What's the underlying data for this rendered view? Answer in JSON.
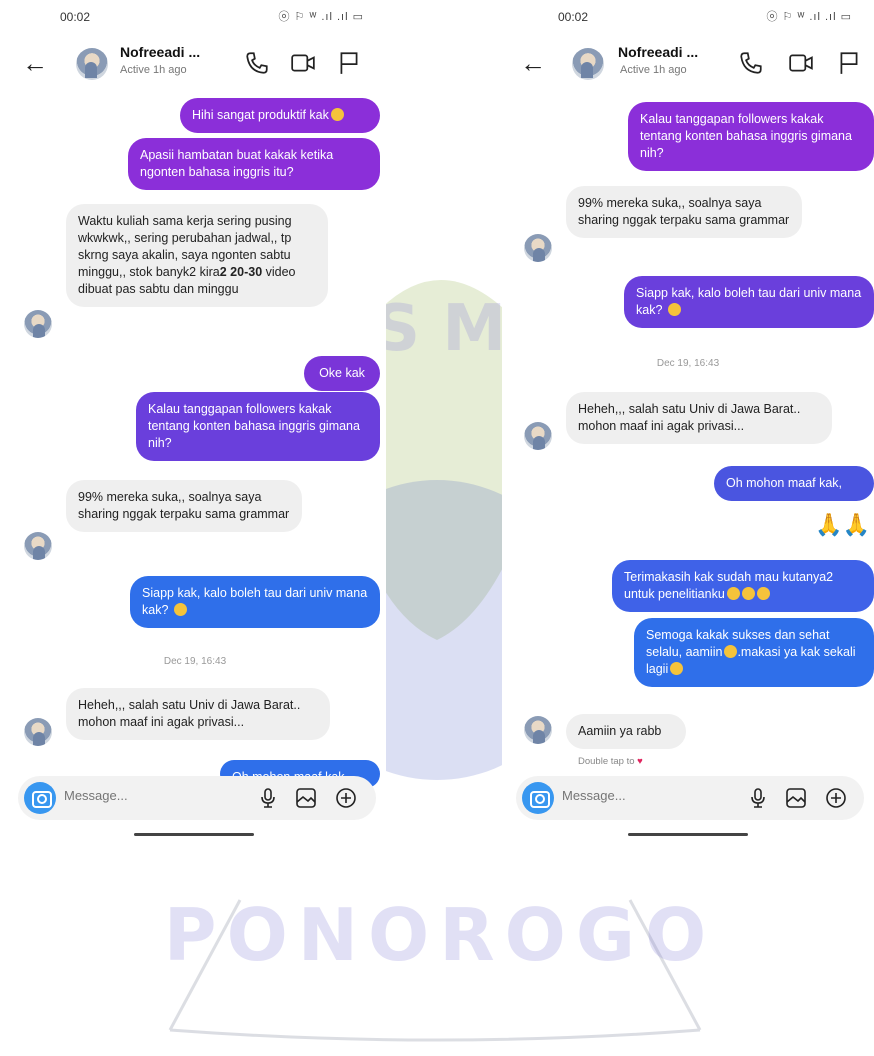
{
  "colors": {
    "bubble_purple": "#8b2fd9",
    "bubble_violet": "#6a3fdc",
    "bubble_blue": "#2f6fea",
    "incoming_bg": "#efefef",
    "camera_blue": "#3897f0",
    "heart_red": "#e0245e"
  },
  "watermark": {
    "text_top": "S M",
    "text_bottom": "PONOROGO"
  },
  "left": {
    "status": {
      "time": "00:02",
      "icons": "ⓞ ⚐ ᵂ .ıl .ıl ▭"
    },
    "header": {
      "name": "Nofreeadi ...",
      "status": "Active 1h ago"
    },
    "messages": {
      "m1": "Hihi sangat produktif kak",
      "m2": "Apasii hambatan buat kakak ketika ngonten bahasa inggris itu?",
      "m3a": "Waktu kuliah sama kerja sering pusing wkwkwk,, sering perubahan jadwal,, tp skrng saya akalin, saya ngonten sabtu minggu,, stok banyk2 kira",
      "m3b": "2 20-30",
      "m3c": " video dibuat pas sabtu dan minggu",
      "m4": "Oke kak",
      "m5": "Kalau tanggapan followers kakak tentang konten bahasa inggris gimana nih?",
      "m6": "99% mereka suka,, soalnya saya sharing nggak terpaku sama grammar",
      "m7": "Siapp kak, kalo boleh tau dari univ mana kak?",
      "ts": "Dec 19, 16:43",
      "m8": "Heheh,,, salah satu Univ di Jawa Barat.. mohon maaf ini agak privasi...",
      "m9": "Oh mohon maaf kak"
    },
    "input_placeholder": "Message..."
  },
  "right": {
    "status": {
      "time": "00:02",
      "icons": "ⓞ ⚐ ᵂ .ıl .ıl ▭"
    },
    "header": {
      "name": "Nofreeadi ...",
      "status": "Active 1h ago"
    },
    "messages": {
      "m1": "Kalau tanggapan followers kakak tentang konten bahasa inggris gimana nih?",
      "m2": "99% mereka suka,, soalnya saya sharing nggak terpaku sama grammar",
      "m3": "Siapp kak, kalo boleh tau dari univ mana kak?",
      "ts": "Dec 19, 16:43",
      "m4": "Heheh,,, salah satu Univ di Jawa Barat.. mohon maaf ini agak privasi...",
      "m5": "Oh mohon maaf kak,",
      "m6": "🙏🙏",
      "m7": "Terimakasih kak sudah mau kutanya2 untuk penelitianku",
      "m8": "Semoga kakak sukses dan sehat selalu, aamiin",
      "m8b": ".makasi ya kak sekali lagii",
      "m9": "Aamiin ya rabb",
      "double_tap": "Double tap to"
    },
    "input_placeholder": "Message..."
  }
}
